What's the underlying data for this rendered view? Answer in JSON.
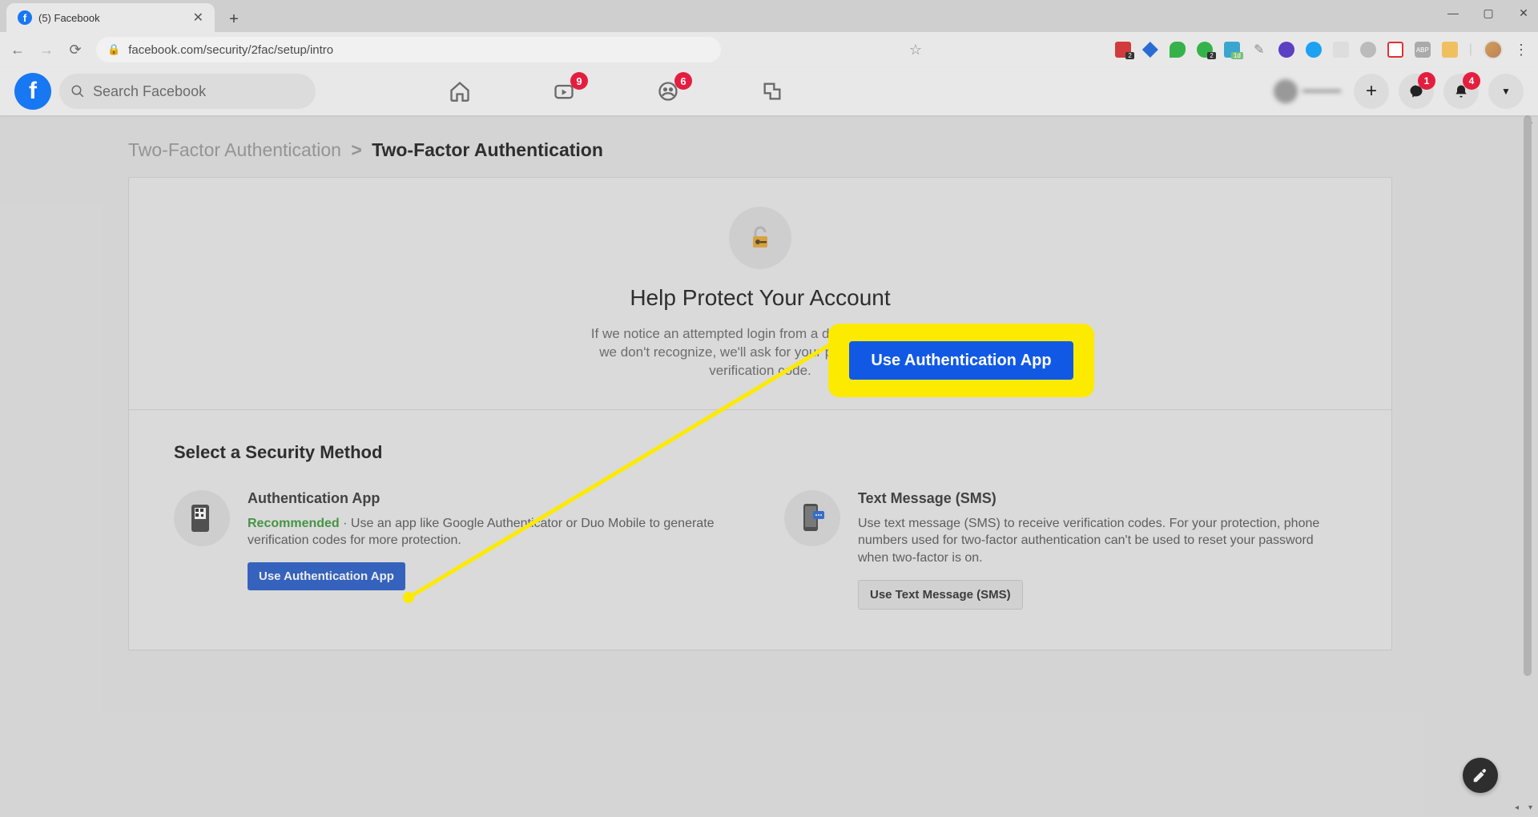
{
  "browser": {
    "tab_title": "(5) Facebook",
    "url": "facebook.com/security/2fac/setup/intro"
  },
  "fb_header": {
    "search_placeholder": "Search Facebook",
    "watch_badge": "9",
    "groups_badge": "6",
    "messenger_badge": "1",
    "notif_badge": "4",
    "profile_name": "———"
  },
  "breadcrumb": {
    "parent": "Two-Factor Authentication",
    "current": "Two-Factor Authentication"
  },
  "hero": {
    "title": "Help Protect Your Account",
    "subtitle": "If we notice an attempted login from a device or browser we don't recognize, we'll ask for your password and a verification code."
  },
  "section_title": "Select a Security Method",
  "methods": {
    "app": {
      "title": "Authentication App",
      "recommended": "Recommended",
      "desc_prefix": " · ",
      "desc": "Use an app like Google Authenticator or Duo Mobile to generate verification codes for more protection.",
      "button": "Use Authentication App"
    },
    "sms": {
      "title": "Text Message (SMS)",
      "desc": "Use text message (SMS) to receive verification codes. For your protection, phone numbers used for two-factor authentication can't be used to reset your password when two-factor is on.",
      "button": "Use Text Message (SMS)"
    }
  },
  "callout": {
    "label": "Use Authentication App"
  }
}
